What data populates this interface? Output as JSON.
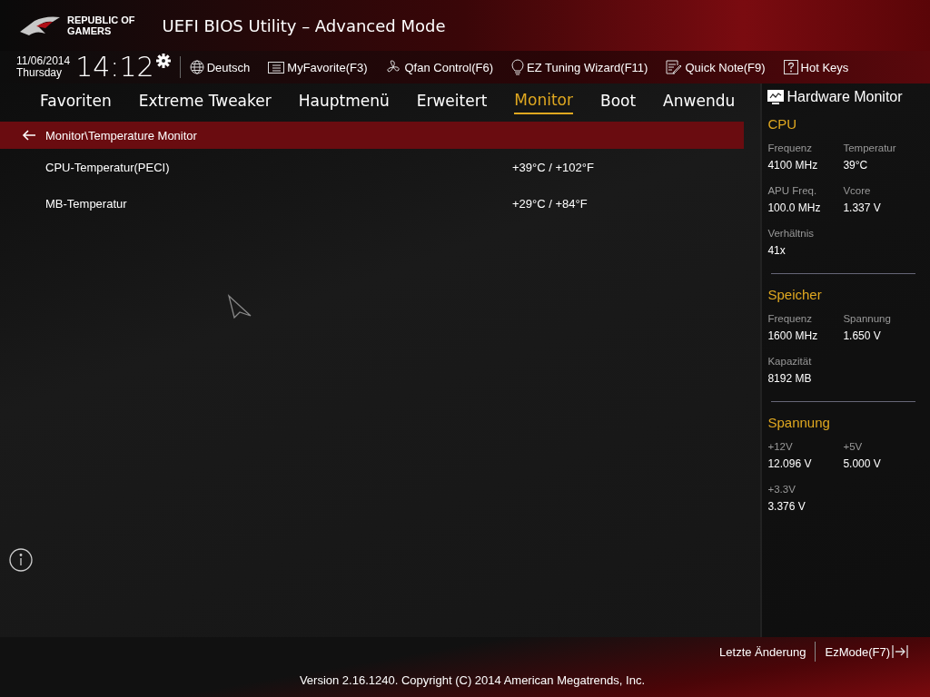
{
  "header": {
    "brand_line_1": "REPUBLIC OF",
    "brand_line_2": "GAMERS",
    "title": "UEFI BIOS Utility – Advanced Mode"
  },
  "toolbar": {
    "date": "11/06/2014",
    "weekday": "Thursday",
    "time": "14:12",
    "items": [
      {
        "kind": "language",
        "label": "Deutsch"
      },
      {
        "kind": "favorite",
        "label": "MyFavorite(F3)"
      },
      {
        "kind": "fan",
        "label": "Qfan Control(F6)"
      },
      {
        "kind": "wizard",
        "label": "EZ Tuning Wizard(F11)"
      },
      {
        "kind": "note",
        "label": "Quick Note(F9)"
      },
      {
        "kind": "help",
        "label": "Hot Keys"
      }
    ]
  },
  "tabs": [
    {
      "label": "Favoriten",
      "selected": false
    },
    {
      "label": "Extreme Tweaker",
      "selected": false
    },
    {
      "label": "Hauptmenü",
      "selected": false
    },
    {
      "label": "Erweitert",
      "selected": false
    },
    {
      "label": "Monitor",
      "selected": true
    },
    {
      "label": "Boot",
      "selected": false
    },
    {
      "label": "Anwendu",
      "selected": false
    }
  ],
  "breadcrumb": "Monitor\\Temperature Monitor",
  "settings": [
    {
      "label": "CPU-Temperatur(PECI)",
      "value": "+39°C / +102°F"
    },
    {
      "label": "MB-Temperatur",
      "value": "+29°C / +84°F"
    }
  ],
  "hardware_monitor": {
    "title": "Hardware Monitor",
    "sections": [
      {
        "title": "CPU",
        "items": [
          {
            "label": "Frequenz",
            "value": "4100 MHz"
          },
          {
            "label": "Temperatur",
            "value": "39°C"
          },
          {
            "label": "APU Freq.",
            "value": "100.0 MHz"
          },
          {
            "label": "Vcore",
            "value": "1.337 V"
          },
          {
            "label": "Verhältnis",
            "value": "41x"
          }
        ]
      },
      {
        "title": "Speicher",
        "items": [
          {
            "label": "Frequenz",
            "value": "1600 MHz"
          },
          {
            "label": "Spannung",
            "value": "1.650 V"
          },
          {
            "label": "Kapazität",
            "value": "8192 MB"
          }
        ]
      },
      {
        "title": "Spannung",
        "items": [
          {
            "label": "+12V",
            "value": "12.096 V"
          },
          {
            "label": "+5V",
            "value": "5.000 V"
          },
          {
            "label": "+3.3V",
            "value": "3.376 V"
          }
        ]
      }
    ]
  },
  "footer": {
    "last_change": "Letzte Änderung",
    "ez_mode": "EzMode(F7)",
    "version": "Version 2.16.1240. Copyright (C) 2014 American Megatrends, Inc."
  }
}
